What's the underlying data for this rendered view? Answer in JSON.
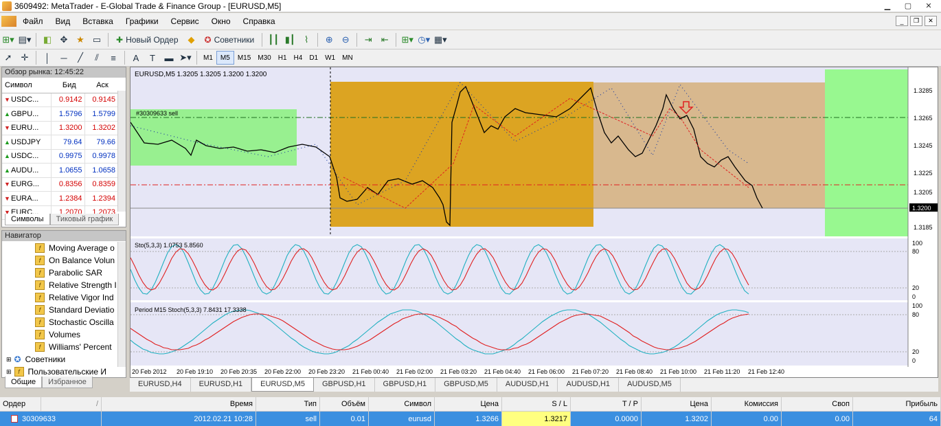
{
  "window": {
    "title": "3609492: MetaTrader - E-Global Trade & Finance Group - [EURUSD,M5]"
  },
  "menu": [
    "Файл",
    "Вид",
    "Вставка",
    "Графики",
    "Сервис",
    "Окно",
    "Справка"
  ],
  "toolbar": {
    "new_order": "Новый Ордер",
    "experts": "Советники"
  },
  "timeframes": [
    "M1",
    "M5",
    "M15",
    "M30",
    "H1",
    "H4",
    "D1",
    "W1",
    "MN"
  ],
  "timeframe_selected": "M5",
  "market_watch": {
    "title": "Обзор рынка: 12:45:22",
    "headers": {
      "symbol": "Символ",
      "bid": "Бид",
      "ask": "Аск"
    },
    "rows": [
      {
        "symbol": "USDC...",
        "bid": "0.9142",
        "ask": "0.9145",
        "dir": "down"
      },
      {
        "symbol": "GBPU...",
        "bid": "1.5796",
        "ask": "1.5799",
        "dir": "up"
      },
      {
        "symbol": "EURU...",
        "bid": "1.3200",
        "ask": "1.3202",
        "dir": "down"
      },
      {
        "symbol": "USDJPY",
        "bid": "79.64",
        "ask": "79.66",
        "dir": "up"
      },
      {
        "symbol": "USDC...",
        "bid": "0.9975",
        "ask": "0.9978",
        "dir": "up"
      },
      {
        "symbol": "AUDU...",
        "bid": "1.0655",
        "ask": "1.0658",
        "dir": "up"
      },
      {
        "symbol": "EURG...",
        "bid": "0.8356",
        "ask": "0.8359",
        "dir": "down"
      },
      {
        "symbol": "EURA...",
        "bid": "1.2384",
        "ask": "1.2394",
        "dir": "down"
      },
      {
        "symbol": "EURC...",
        "bid": "1.2070",
        "ask": "1.2073",
        "dir": "down"
      }
    ],
    "tabs": [
      "Символы",
      "Тиковый график"
    ]
  },
  "navigator": {
    "title": "Навигатор",
    "items": [
      "Moving Average o",
      "On Balance Volun",
      "Parabolic SAR",
      "Relative Strength I",
      "Relative Vigor Ind",
      "Standard Deviatio",
      "Stochastic Oscilla",
      "Volumes",
      "Williams' Percent"
    ],
    "folders": [
      "Советники",
      "Пользовательские И"
    ],
    "tabs": [
      "Общие",
      "Избранное"
    ]
  },
  "chart": {
    "header": "EURUSD,M5  1.3205 1.3205 1.3200 1.3200",
    "order_label": "#30309633 sell",
    "price_ticks": [
      "1.3285",
      "1.3265",
      "1.3245",
      "1.3225",
      "1.3205",
      "1.3185"
    ],
    "current_price": "1.3200",
    "sub1_header": "Sto(5,3,3) 1.0753 5.8560",
    "sub1_ticks": [
      "100",
      "80",
      "20",
      "0"
    ],
    "sub2_header": "Period M15 Stoch(5,3,3) 7.8431 17.3338",
    "sub2_ticks": [
      "100",
      "80",
      "20",
      "0"
    ],
    "time_labels": [
      "20 Feb 2012",
      "20 Feb 19:10",
      "20 Feb 20:35",
      "20 Feb 22:00",
      "20 Feb 23:20",
      "21 Feb 00:40",
      "21 Feb 02:00",
      "21 Feb 03:20",
      "21 Feb 04:40",
      "21 Feb 06:00",
      "21 Feb 07:20",
      "21 Feb 08:40",
      "21 Feb 10:00",
      "21 Feb 11:20",
      "21 Feb 12:40"
    ]
  },
  "chart_tabs": [
    "EURUSD,H4",
    "EURUSD,H1",
    "EURUSD,M5",
    "GBPUSD,H1",
    "GBPUSD,H1",
    "GBPUSD,M5",
    "AUDUSD,H1",
    "AUDUSD,H1",
    "AUDUSD,M5"
  ],
  "chart_tab_selected": "EURUSD,M5",
  "terminal": {
    "headers": [
      "Ордер",
      "/",
      "Время",
      "Тип",
      "Объём",
      "Символ",
      "Цена",
      "S / L",
      "T / P",
      "Цена",
      "Комиссия",
      "Своп",
      "Прибыль"
    ],
    "row": {
      "order": "30309633",
      "time": "2012.02.21 10:28",
      "type": "sell",
      "volume": "0.01",
      "symbol": "eurusd",
      "price": "1.3266",
      "sl": "1.3217",
      "tp": "0.0000",
      "price_now": "1.3202",
      "commission": "0.00",
      "swap": "0.00",
      "profit": "64"
    }
  }
}
